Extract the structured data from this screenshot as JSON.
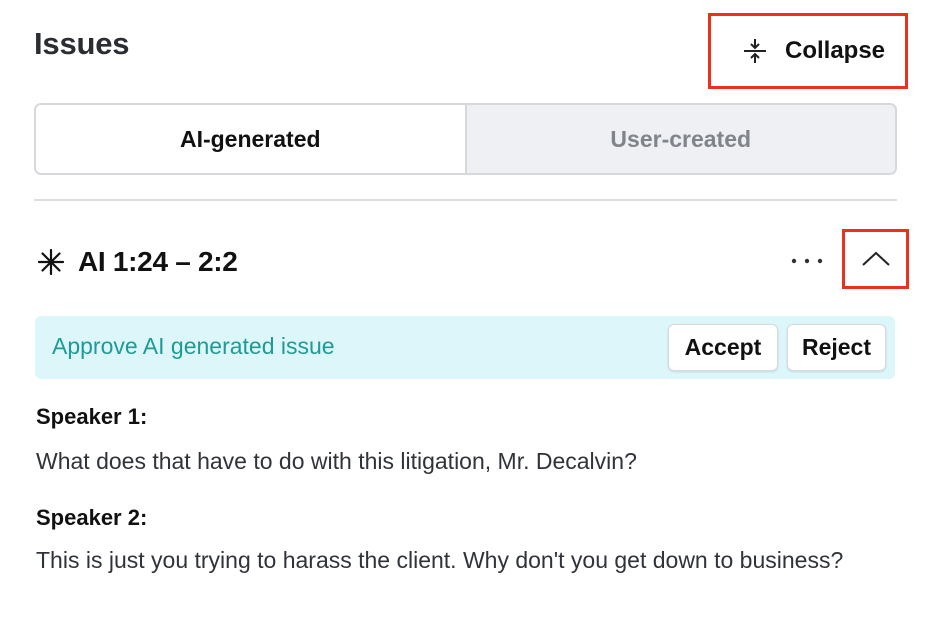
{
  "header": {
    "title": "Issues",
    "collapse_label": "Collapse",
    "collapse_icon": "collapse-vertical-icon"
  },
  "tabs": [
    {
      "label": "AI-generated",
      "active": true
    },
    {
      "label": "User-created",
      "active": false
    }
  ],
  "issue": {
    "icon": "sparkle-icon",
    "title": "AI 1:24 – 2:2",
    "more_icon": "more-horizontal-icon",
    "toggle_icon": "chevron-up-icon"
  },
  "approval": {
    "text": "Approve AI generated issue",
    "accept_label": "Accept",
    "reject_label": "Reject"
  },
  "transcript": [
    {
      "speaker": "Speaker 1:",
      "text": "What does that have to do with this litigation, Mr. Decalvin?"
    },
    {
      "speaker": "Speaker 2:",
      "text": "This is just you trying to harass the client. Why don't you get down to business?"
    }
  ],
  "colors": {
    "highlight_border": "#e8321c",
    "approve_bg": "#ddf6f9",
    "approve_text": "#1f9b96",
    "inactive_tab_bg": "#eef0f3"
  }
}
